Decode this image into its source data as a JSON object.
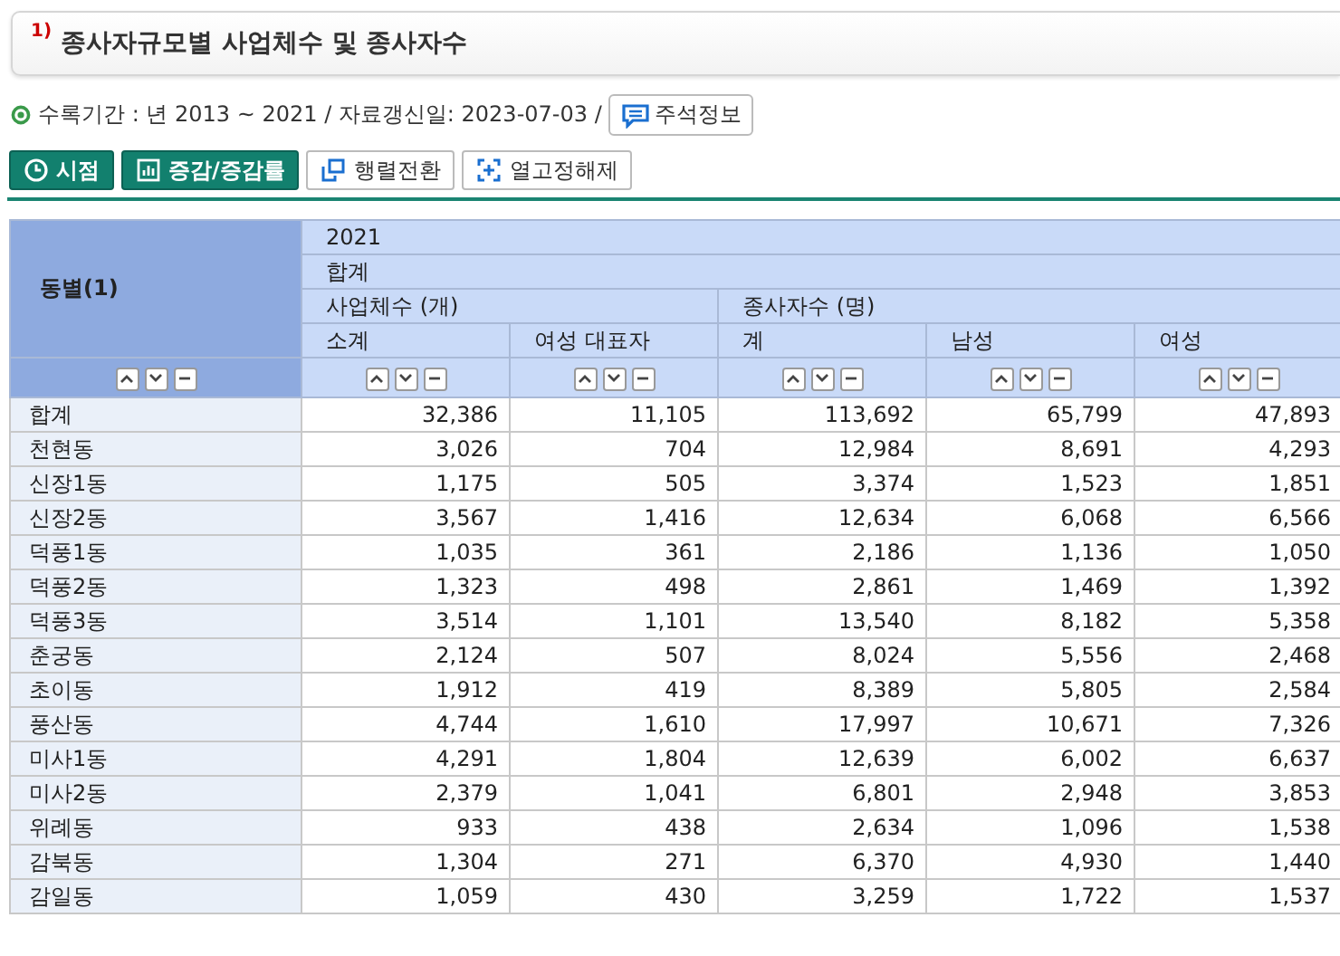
{
  "title": {
    "footnote": "1)",
    "text": "종사자규모별 사업체수 및 종사자수"
  },
  "info": {
    "text": "수록기간 : 년 2013 ~ 2021 / 자료갱신일: 2023-07-03 /",
    "button": "주석정보"
  },
  "toolbar": [
    {
      "label": "시점",
      "kind": "primary"
    },
    {
      "label": "증감/증감률",
      "kind": "primary"
    },
    {
      "label": "행렬전환",
      "kind": "secondary"
    },
    {
      "label": "열고정해제",
      "kind": "secondary"
    }
  ],
  "table": {
    "row_header": "동별(1)",
    "year": "2021",
    "group": "합계",
    "categories": [
      {
        "label": "사업체수 (개)",
        "columns": [
          "소계",
          "여성 대표자"
        ]
      },
      {
        "label": "종사자수 (명)",
        "columns": [
          "계",
          "남성",
          "여성"
        ]
      }
    ],
    "rows": [
      {
        "name": "합계",
        "values": [
          "32,386",
          "11,105",
          "113,692",
          "65,799",
          "47,893"
        ]
      },
      {
        "name": "천현동",
        "values": [
          "3,026",
          "704",
          "12,984",
          "8,691",
          "4,293"
        ]
      },
      {
        "name": "신장1동",
        "values": [
          "1,175",
          "505",
          "3,374",
          "1,523",
          "1,851"
        ]
      },
      {
        "name": "신장2동",
        "values": [
          "3,567",
          "1,416",
          "12,634",
          "6,068",
          "6,566"
        ]
      },
      {
        "name": "덕풍1동",
        "values": [
          "1,035",
          "361",
          "2,186",
          "1,136",
          "1,050"
        ]
      },
      {
        "name": "덕풍2동",
        "values": [
          "1,323",
          "498",
          "2,861",
          "1,469",
          "1,392"
        ]
      },
      {
        "name": "덕풍3동",
        "values": [
          "3,514",
          "1,101",
          "13,540",
          "8,182",
          "5,358"
        ]
      },
      {
        "name": "춘궁동",
        "values": [
          "2,124",
          "507",
          "8,024",
          "5,556",
          "2,468"
        ]
      },
      {
        "name": "초이동",
        "values": [
          "1,912",
          "419",
          "8,389",
          "5,805",
          "2,584"
        ]
      },
      {
        "name": "풍산동",
        "values": [
          "4,744",
          "1,610",
          "17,997",
          "10,671",
          "7,326"
        ]
      },
      {
        "name": "미사1동",
        "values": [
          "4,291",
          "1,804",
          "12,639",
          "6,002",
          "6,637"
        ]
      },
      {
        "name": "미사2동",
        "values": [
          "2,379",
          "1,041",
          "6,801",
          "2,948",
          "3,853"
        ]
      },
      {
        "name": "위례동",
        "values": [
          "933",
          "438",
          "2,634",
          "1,096",
          "1,538"
        ]
      },
      {
        "name": "감북동",
        "values": [
          "1,304",
          "271",
          "6,370",
          "4,930",
          "1,440"
        ]
      },
      {
        "name": "감일동",
        "values": [
          "1,059",
          "430",
          "3,259",
          "1,722",
          "1,537"
        ]
      }
    ]
  }
}
